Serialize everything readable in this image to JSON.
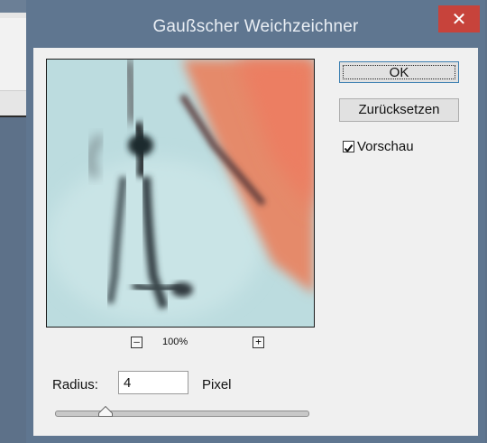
{
  "dialog": {
    "title": "Gaußscher Weichzeichner",
    "close_glyph": "✕",
    "ok_label": "OK",
    "reset_label": "Zurücksetzen",
    "preview_checkbox": {
      "label": "Vorschau",
      "checked": true
    }
  },
  "zoom": {
    "minus_glyph": "–",
    "value": "100%",
    "plus_glyph": "+"
  },
  "radius": {
    "label": "Radius:",
    "value": "4",
    "unit": "Pixel",
    "slider_level": 0.2
  },
  "colors": {
    "titlebar": "#5f7690",
    "close_button": "#c7433b",
    "client_background": "#f0f0f0",
    "preview_base": "#bfdde0",
    "preview_accent": "#e58a6a"
  },
  "icons": [
    "close-icon",
    "zoom-out-icon",
    "zoom-in-icon",
    "checkmark-icon",
    "slider-thumb-icon"
  ]
}
